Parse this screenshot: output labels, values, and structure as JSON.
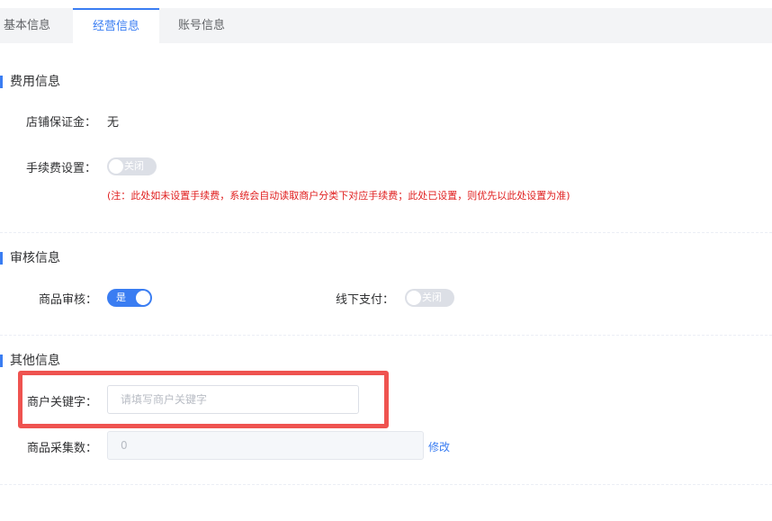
{
  "tabs": [
    {
      "label": "基本信息"
    },
    {
      "label": "经营信息",
      "active": true
    },
    {
      "label": "账号信息"
    }
  ],
  "fee_section": {
    "title": "费用信息",
    "deposit_label": "店铺保证金：",
    "deposit_value": "无",
    "fee_label": "手续费设置：",
    "fee_switch": {
      "state": "off",
      "text": "关闭"
    },
    "note": "(注：此处如未设置手续费，系统会自动读取商户分类下对应手续费；此处已设置，则优先以此处设置为准)"
  },
  "audit_section": {
    "title": "审核信息",
    "product_audit_label": "商品审核：",
    "product_audit_switch": {
      "state": "on",
      "text": "是"
    },
    "offline_pay_label": "线下支付：",
    "offline_pay_switch": {
      "state": "off",
      "text": "关闭"
    }
  },
  "other_section": {
    "title": "其他信息",
    "keyword_label": "商户关键字：",
    "keyword_placeholder": "请填写商户关键字",
    "keyword_value": "",
    "collect_label": "商品采集数：",
    "collect_value": "0",
    "edit_link": "修改"
  },
  "colors": {
    "accent": "#3a7df2",
    "note_red": "#e02020",
    "highlight_red": "#ef5350"
  }
}
